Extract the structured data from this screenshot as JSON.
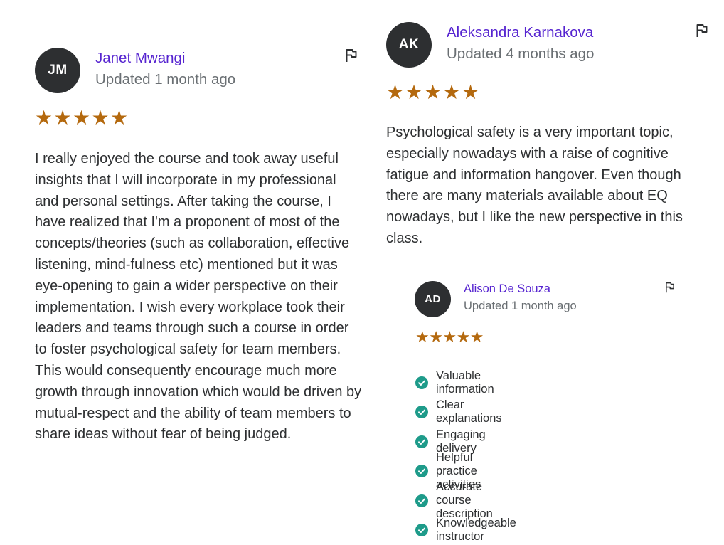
{
  "colors": {
    "name": "#5624d0",
    "meta": "#6a6f73",
    "star": "#b4690e",
    "avatar_bg": "#2d2f31",
    "check": "#1e9b8a"
  },
  "reviews": [
    {
      "initials": "JM",
      "name": "Janet Mwangi",
      "updated": "Updated 1 month ago",
      "rating": 5,
      "text": "I really enjoyed the course and took away useful insights that I will incorporate in my professional and personal settings. After taking the course, I have realized that I'm a proponent of most of the concepts/theories (such as collaboration, effective listening, mind-fulness etc) mentioned but it was eye-opening to gain a wider perspective on their implementation. I wish every workplace took their leaders and teams through such a course in order to foster psychological safety for team members. This would consequently encourage much more growth through innovation which would be driven by mutual-respect and the ability of team members to share ideas without fear of being judged."
    },
    {
      "initials": "AK",
      "name": "Aleksandra Karnakova",
      "updated": "Updated 4 months ago",
      "rating": 5,
      "text": "Psychological safety is a very important topic, especially nowadays with a raise of cognitive fatigue and information hangover. Even though there are many materials available about EQ nowadays, but I like the new perspective in this class."
    },
    {
      "initials": "AD",
      "name": "Alison De Souza",
      "updated": "Updated 1 month ago",
      "rating": 5,
      "highlights": [
        "Valuable information",
        "Clear explanations",
        "Engaging delivery",
        "Helpful practice activities",
        "Accurate course description",
        "Knowledgeable instructor"
      ]
    }
  ],
  "icons": {
    "flag": "flag-icon",
    "star": "star-icon",
    "check": "check-circle-icon"
  }
}
